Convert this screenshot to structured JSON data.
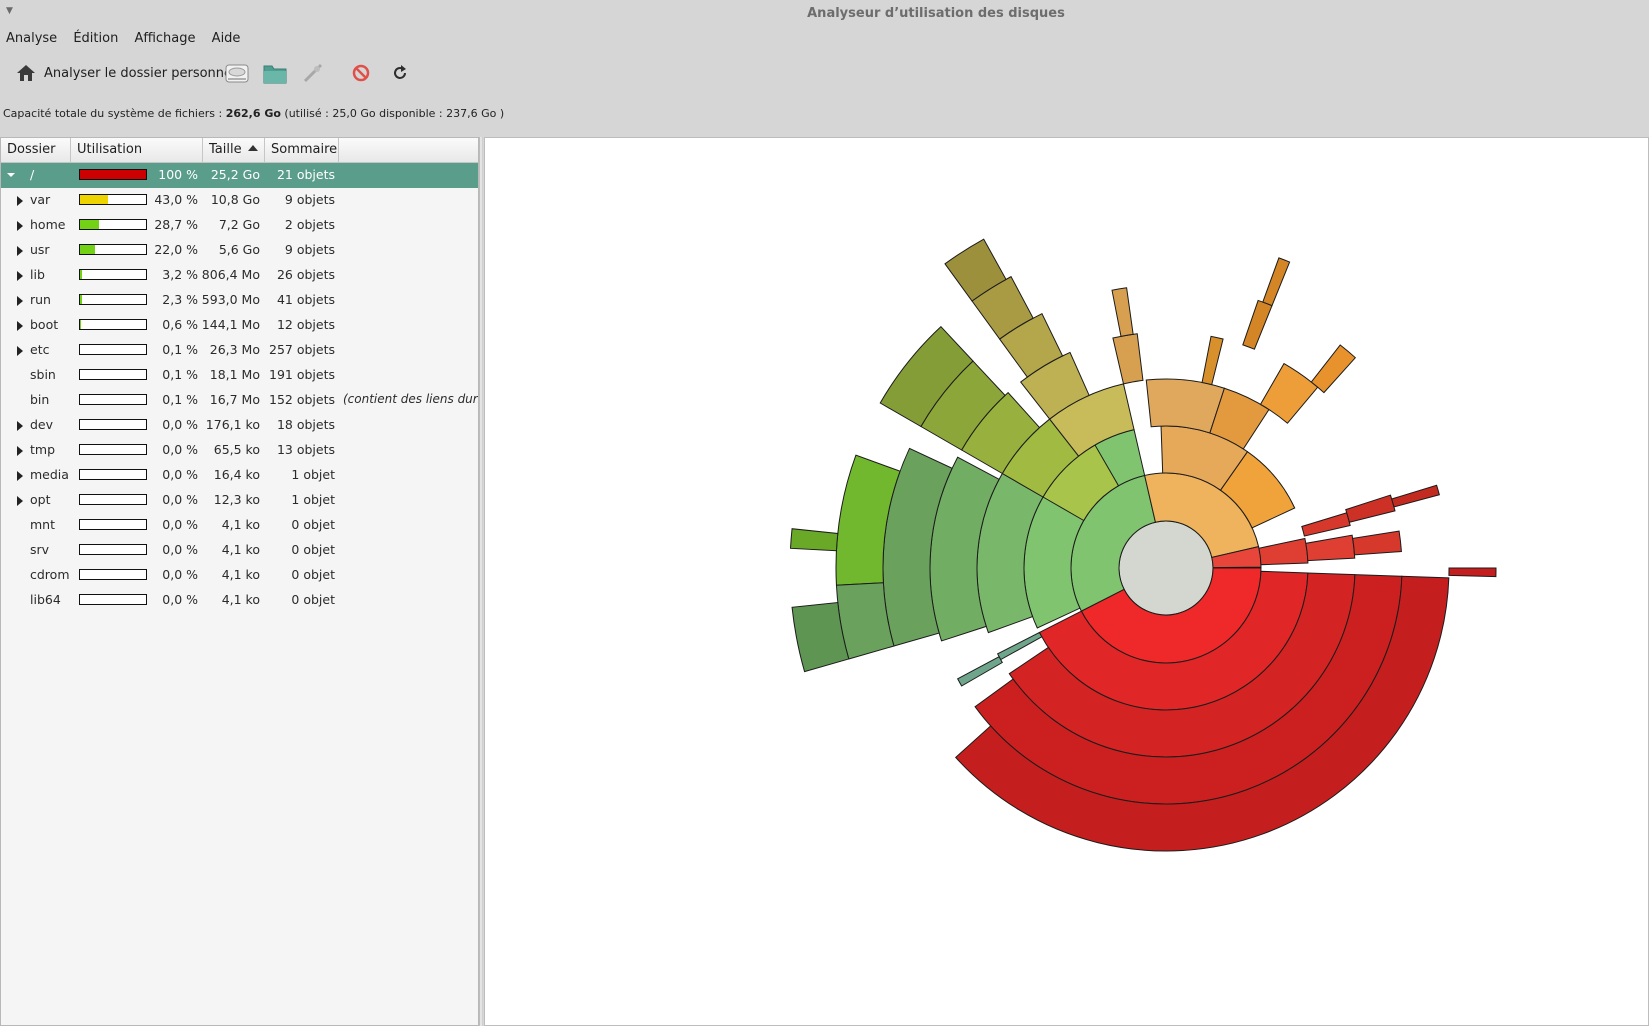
{
  "window": {
    "title": "Analyseur d’utilisation des disques",
    "wm_menu_icon": "down-triangle-icon"
  },
  "menubar": {
    "items": [
      "Analyse",
      "Édition",
      "Affichage",
      "Aide"
    ]
  },
  "toolbar": {
    "scan_home_label": "Analyser le dossier personnel",
    "icons": [
      "home-icon",
      "harddisk-icon",
      "folder-icon",
      "remote-icon",
      "stop-icon",
      "refresh-icon"
    ]
  },
  "capacity": {
    "prefix": "Capacité totale du système de fichiers :",
    "total": "262,6 Go",
    "rest": "(utilisé : 25,0 Go disponible : 237,6 Go )"
  },
  "table": {
    "columns": [
      "Dossier",
      "Utilisation",
      "Taille",
      "Sommaire"
    ],
    "sort_column": "Taille",
    "rows": [
      {
        "name": "/",
        "usage": 1.0,
        "pct": "100 %",
        "size": "25,2 Go",
        "items": "21 objets",
        "expander": "open",
        "selected": true,
        "bar_color": "#cc0000"
      },
      {
        "name": "var",
        "usage": 0.43,
        "pct": "43,0 %",
        "size": "10,8 Go",
        "items": "9 objets",
        "expander": "closed",
        "bar_color": "#edd400"
      },
      {
        "name": "home",
        "usage": 0.287,
        "pct": "28,7 %",
        "size": "7,2 Go",
        "items": "2 objets",
        "expander": "closed",
        "bar_color": "#73d216"
      },
      {
        "name": "usr",
        "usage": 0.22,
        "pct": "22,0 %",
        "size": "5,6 Go",
        "items": "9 objets",
        "expander": "closed",
        "bar_color": "#73d216"
      },
      {
        "name": "lib",
        "usage": 0.032,
        "pct": "3,2 %",
        "size": "806,4 Mo",
        "items": "26 objets",
        "expander": "closed",
        "bar_color": "#73d216"
      },
      {
        "name": "run",
        "usage": 0.023,
        "pct": "2,3 %",
        "size": "593,0 Mo",
        "items": "41 objets",
        "expander": "closed",
        "bar_color": "#73d216"
      },
      {
        "name": "boot",
        "usage": 0.006,
        "pct": "0,6 %",
        "size": "144,1 Mo",
        "items": "12 objets",
        "expander": "closed",
        "bar_color": "#73d216"
      },
      {
        "name": "etc",
        "usage": 0.001,
        "pct": "0,1 %",
        "size": "26,3 Mo",
        "items": "257 objets",
        "expander": "closed",
        "bar_color": "#73d216"
      },
      {
        "name": "sbin",
        "usage": 0.001,
        "pct": "0,1 %",
        "size": "18,1 Mo",
        "items": "191 objets",
        "expander": "none",
        "bar_color": "#73d216"
      },
      {
        "name": "bin",
        "usage": 0.001,
        "pct": "0,1 %",
        "size": "16,7 Mo",
        "items": "152 objets",
        "expander": "none",
        "bar_color": "#73d216",
        "note": "(contient des liens durs ve"
      },
      {
        "name": "dev",
        "usage": 0.0,
        "pct": "0,0 %",
        "size": "176,1 ko",
        "items": "18 objets",
        "expander": "closed",
        "bar_color": "#73d216"
      },
      {
        "name": "tmp",
        "usage": 0.0,
        "pct": "0,0 %",
        "size": "65,5 ko",
        "items": "13 objets",
        "expander": "closed",
        "bar_color": "#73d216"
      },
      {
        "name": "media",
        "usage": 0.0,
        "pct": "0,0 %",
        "size": "16,4 ko",
        "items": "1 objet",
        "expander": "closed",
        "bar_color": "#73d216"
      },
      {
        "name": "opt",
        "usage": 0.0,
        "pct": "0,0 %",
        "size": "12,3 ko",
        "items": "1 objet",
        "expander": "closed",
        "bar_color": "#73d216"
      },
      {
        "name": "mnt",
        "usage": 0.0,
        "pct": "0,0 %",
        "size": "4,1 ko",
        "items": "0 objet",
        "expander": "none",
        "bar_color": "#73d216"
      },
      {
        "name": "srv",
        "usage": 0.0,
        "pct": "0,0 %",
        "size": "4,1 ko",
        "items": "0 objet",
        "expander": "none",
        "bar_color": "#73d216"
      },
      {
        "name": "cdrom",
        "usage": 0.0,
        "pct": "0,0 %",
        "size": "4,1 ko",
        "items": "0 objet",
        "expander": "none",
        "bar_color": "#73d216"
      },
      {
        "name": "lib64",
        "usage": 0.0,
        "pct": "0,0 %",
        "size": "4,1 ko",
        "items": "0 objet",
        "expander": "none",
        "bar_color": "#73d216"
      }
    ]
  },
  "chart_data": {
    "type": "sunburst",
    "root": "/",
    "center_color": "#d3d7cf",
    "ring_colors": {
      "red": [
        "#ef2929",
        "#e02626",
        "#d42323",
        "#cc2020",
        "#c41e1e"
      ],
      "orange": [
        "#eeb35c",
        "#f0a33a",
        "#e48f2a",
        "#d8801e",
        "#cf7718"
      ],
      "green": [
        "#80c46f",
        "#79b86a",
        "#72ad64",
        "#6aa25d",
        "#5f9553"
      ],
      "olive": [
        "#c8bb5a",
        "#bdb153",
        "#b3a64b",
        "#a89b44",
        "#9d903c"
      ],
      "vred": [
        "#e8463a",
        "#df3f33",
        "#d6382c",
        "#cd3126",
        "#c42b20"
      ]
    },
    "first_level": [
      {
        "name": "var",
        "share": 0.43,
        "color": "red"
      },
      {
        "name": "home",
        "share": 0.287,
        "color": "green"
      },
      {
        "name": "usr",
        "share": 0.22,
        "color": "orange"
      },
      {
        "name": "lib",
        "share": 0.032,
        "color": "vred"
      },
      {
        "name": "run",
        "share": 0.023,
        "color": "vred"
      },
      {
        "name": "boot",
        "share": 0.006,
        "color": "vred"
      }
    ]
  }
}
